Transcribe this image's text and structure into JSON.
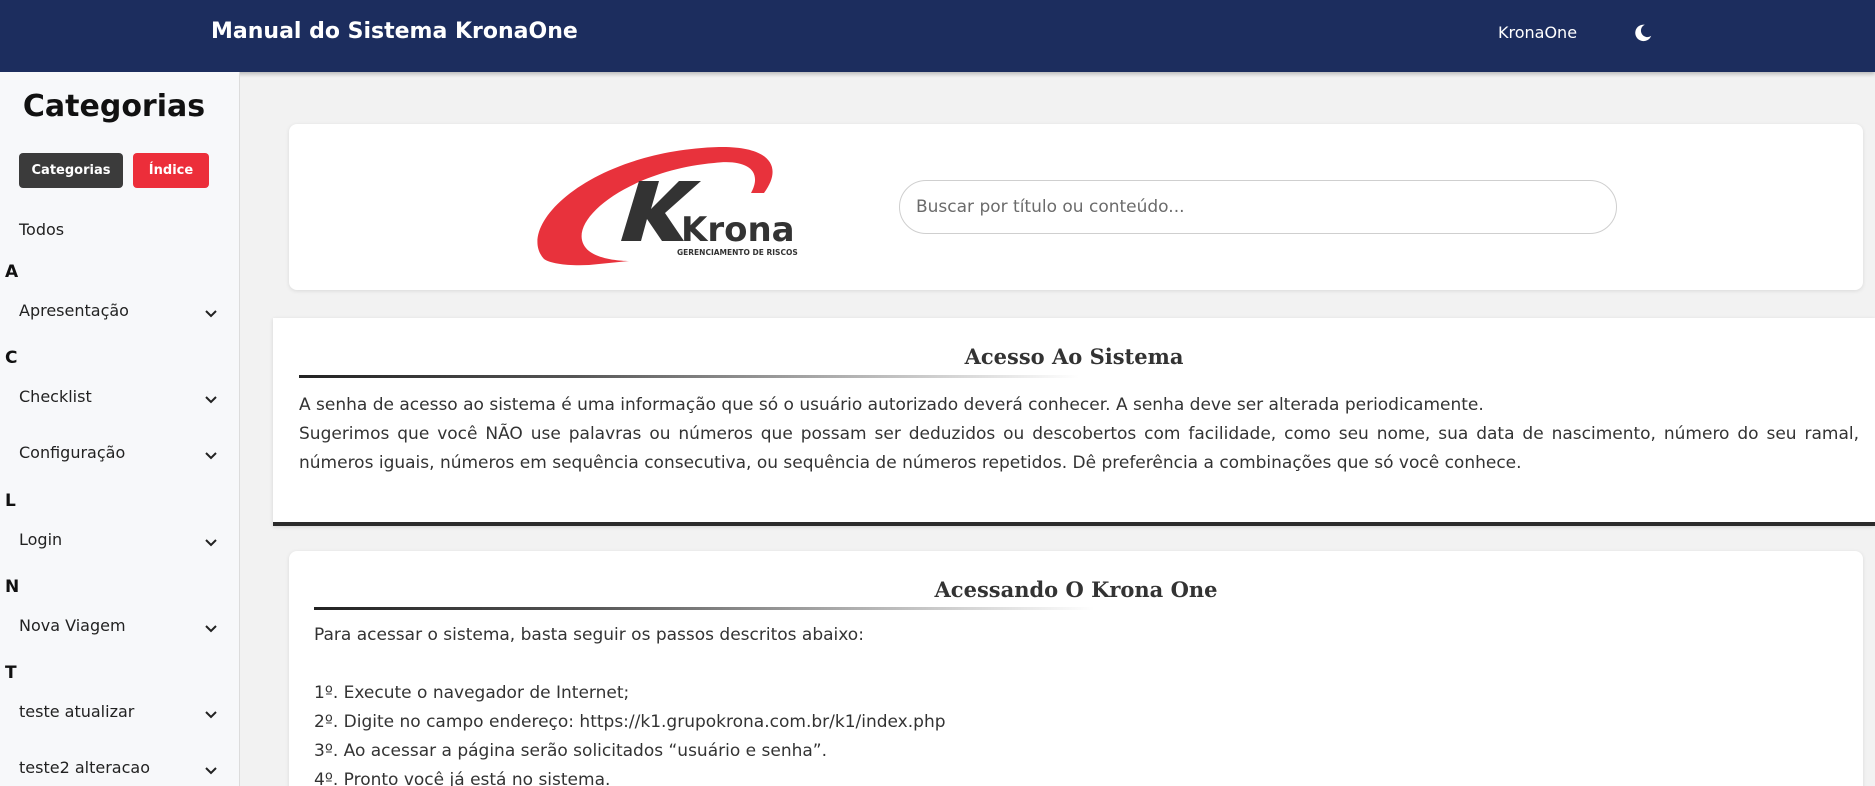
{
  "header": {
    "title": "Manual do Sistema KronaOne",
    "brand_link": "KronaOne",
    "theme_icon": "moon-icon"
  },
  "sidebar": {
    "title": "Categorias",
    "buttons": {
      "categories": "Categorias",
      "index": "Índice"
    },
    "all_label": "Todos",
    "groups": [
      {
        "letter": "A",
        "items": [
          "Apresentação"
        ]
      },
      {
        "letter": "C",
        "items": [
          "Checklist",
          "Configuração"
        ]
      },
      {
        "letter": "L",
        "items": [
          "Login"
        ]
      },
      {
        "letter": "N",
        "items": [
          "Nova Viagem"
        ]
      },
      {
        "letter": "T",
        "items": [
          "teste atualizar",
          "teste2 alteracao"
        ]
      }
    ]
  },
  "logo": {
    "name": "Krona",
    "tagline": "GERENCIAMENTO DE RISCOS"
  },
  "search": {
    "placeholder": "Buscar por título ou conteúdo...",
    "value": ""
  },
  "articles": [
    {
      "title": "Acesso Ao Sistema",
      "lines": [
        "A senha de acesso ao sistema é uma informação que só o usuário autorizado deverá conhecer. A senha deve ser alterada periodicamente.",
        "Sugerimos que você NÃO use palavras ou números que possam ser deduzidos ou descobertos com facilidade, como seu nome, sua data de nascimento, número do seu ramal, números iguais, números em sequência consecutiva, ou sequência de números repetidos. Dê preferência a combinações que só você conhece."
      ]
    },
    {
      "title": "Acessando O Krona One",
      "lines": [
        "Para acessar o sistema, basta seguir os passos descritos abaixo:",
        "",
        "1º. Execute o navegador de Internet;",
        "2º. Digite no campo endereço: https://k1.grupokrona.com.br/k1/index.php",
        "3º. Ao acessar a página serão solicitados “usuário e senha”.",
        "4º. Pronto você já está no sistema."
      ]
    }
  ],
  "colors": {
    "header_bg": "#1c2d5e",
    "accent_red": "#ec2e3a",
    "dark_button": "#3b3b3b"
  }
}
